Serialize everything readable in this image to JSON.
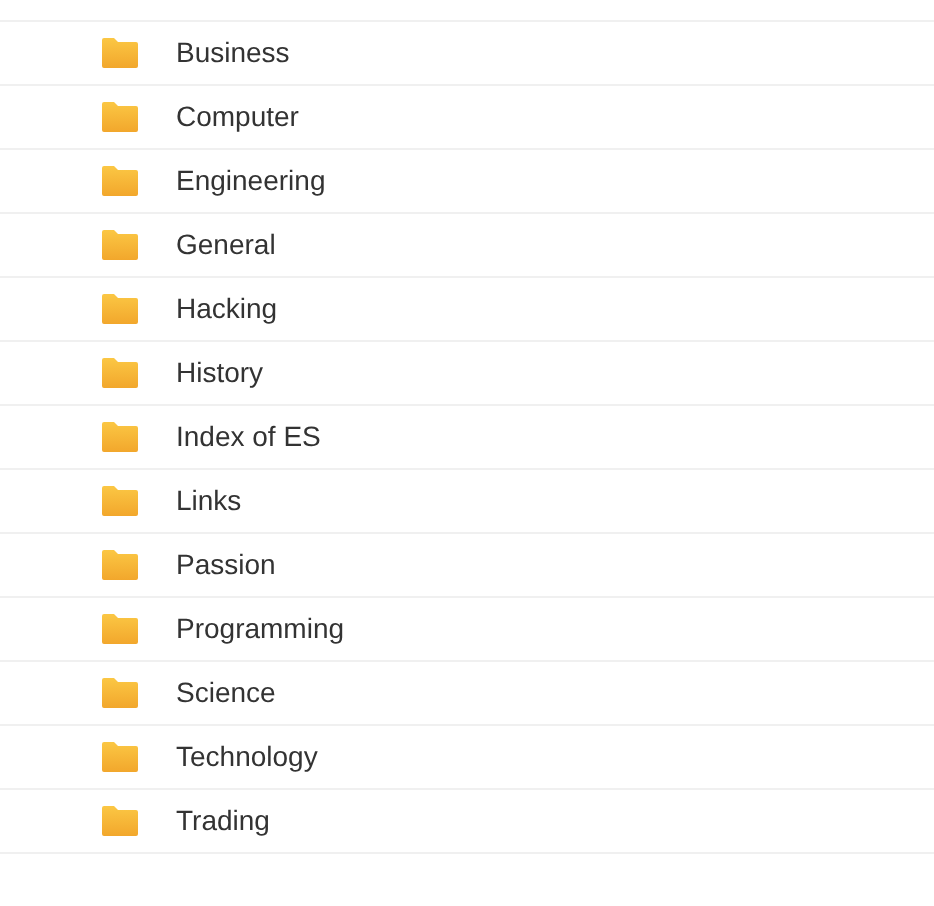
{
  "folders": [
    {
      "name": "Business"
    },
    {
      "name": "Computer"
    },
    {
      "name": "Engineering"
    },
    {
      "name": "General"
    },
    {
      "name": "Hacking"
    },
    {
      "name": "History"
    },
    {
      "name": "Index of ES"
    },
    {
      "name": "Links"
    },
    {
      "name": "Passion"
    },
    {
      "name": "Programming"
    },
    {
      "name": "Science"
    },
    {
      "name": "Technology"
    },
    {
      "name": "Trading"
    }
  ]
}
